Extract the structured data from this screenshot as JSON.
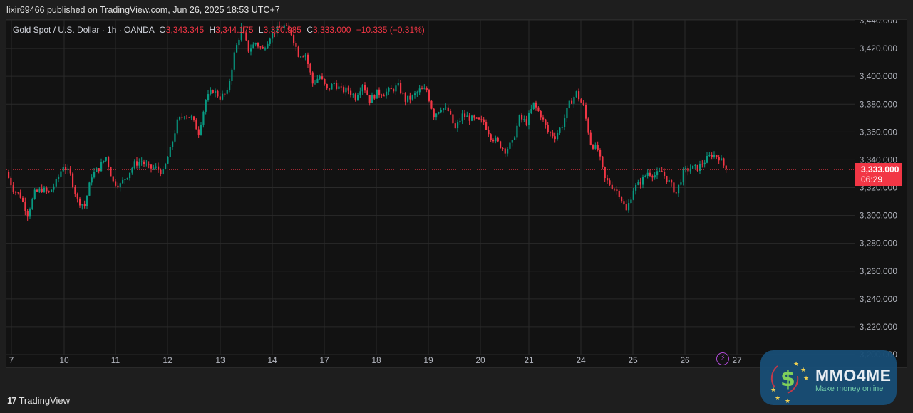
{
  "header": {
    "published": "lixir69466 published on TradingView.com, Jun 26, 2025 18:53 UTC+7"
  },
  "legend": {
    "symbol": "Gold Spot / U.S. Dollar · 1h · OANDA",
    "o_label": "O",
    "o": "3,343.345",
    "h_label": "H",
    "h": "3,344.175",
    "l_label": "L",
    "l": "3,330.985",
    "c_label": "C",
    "c": "3,333.000",
    "change": "−10.335 (−0.31%)"
  },
  "price_tag": {
    "price": "3,333.000",
    "countdown": "06:29"
  },
  "footer": {
    "brand": "TradingView"
  },
  "watermark": {
    "name": "MMO4ME",
    "tagline": "Make money online"
  },
  "colors": {
    "up": "#089981",
    "down": "#f23645",
    "bg": "#121212",
    "grid": "#2a2a2a"
  },
  "chart_data": {
    "type": "candlestick",
    "title": "Gold Spot / U.S. Dollar · 1h · OANDA",
    "ylim": [
      3200,
      3440
    ],
    "yticks": [
      "3,200.000",
      "3,220.000",
      "3,240.000",
      "3,260.000",
      "3,280.000",
      "3,300.000",
      "3,320.000",
      "3,340.000",
      "3,360.000",
      "3,380.000",
      "3,400.000",
      "3,420.000",
      "3,440.000"
    ],
    "ytick_values": [
      3200,
      3220,
      3240,
      3260,
      3280,
      3300,
      3320,
      3340,
      3360,
      3380,
      3400,
      3420,
      3440
    ],
    "xticks": [
      "7",
      "10",
      "11",
      "12",
      "13",
      "14",
      "17",
      "18",
      "19",
      "20",
      "21",
      "24",
      "25",
      "26",
      "27"
    ],
    "last_price": 3333,
    "close_path": [
      3331,
      3319,
      3314,
      3301,
      3316,
      3319,
      3316,
      3324,
      3336,
      3329,
      3311,
      3307,
      3329,
      3334,
      3342,
      3324,
      3322,
      3329,
      3337,
      3339,
      3334,
      3334,
      3331,
      3347,
      3367,
      3373,
      3370,
      3360,
      3383,
      3390,
      3385,
      3388,
      3416,
      3434,
      3419,
      3424,
      3419,
      3429,
      3434,
      3436,
      3431,
      3416,
      3416,
      3395,
      3400,
      3390,
      3395,
      3390,
      3390,
      3385,
      3395,
      3383,
      3388,
      3388,
      3390,
      3393,
      3383,
      3385,
      3390,
      3390,
      3372,
      3378,
      3375,
      3362,
      3372,
      3370,
      3368,
      3367,
      3357,
      3352,
      3347,
      3352,
      3370,
      3367,
      3380,
      3372,
      3360,
      3357,
      3365,
      3380,
      3388,
      3378,
      3352,
      3347,
      3326,
      3321,
      3316,
      3303,
      3319,
      3324,
      3331,
      3329,
      3331,
      3324,
      3316,
      3331,
      3334,
      3334,
      3339,
      3344,
      3342,
      3333
    ]
  }
}
